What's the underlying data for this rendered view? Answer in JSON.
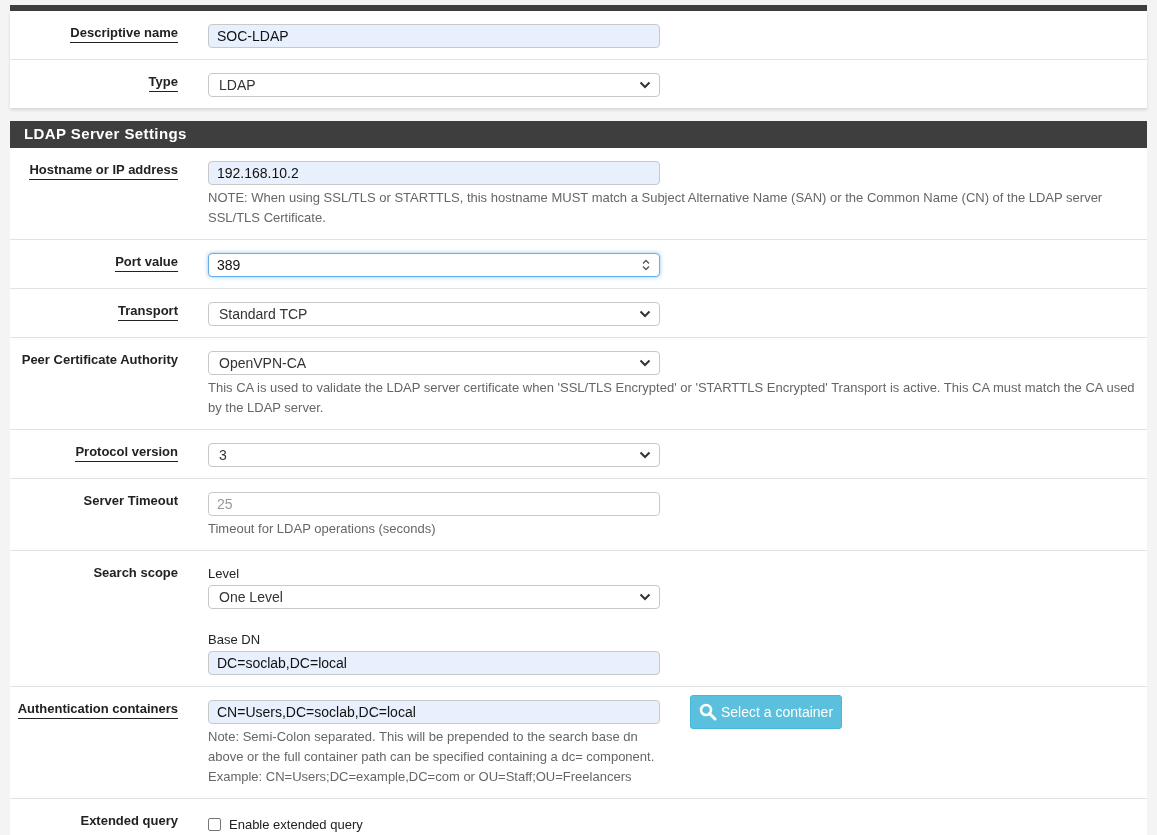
{
  "top_rows": [
    {
      "label": "Descriptive name",
      "help_link": true,
      "kind": "text",
      "value": "SOC-LDAP",
      "autofilled": true
    },
    {
      "label": "Type",
      "help_link": true,
      "kind": "select",
      "value": "LDAP"
    }
  ],
  "section": {
    "title": "LDAP Server Settings",
    "rows": [
      {
        "label": "Hostname or IP address",
        "help_link": true,
        "kind": "text",
        "value": "192.168.10.2",
        "autofilled": true,
        "help": "NOTE: When using SSL/TLS or STARTTLS, this hostname MUST match a Subject Alternative Name (SAN) or the Common Name (CN) of the LDAP server SSL/TLS Certificate."
      },
      {
        "label": "Port value",
        "help_link": true,
        "kind": "number",
        "value": "389",
        "focused": true
      },
      {
        "label": "Transport",
        "help_link": true,
        "kind": "select",
        "value": "Standard TCP"
      },
      {
        "label": "Peer Certificate Authority",
        "help_link": false,
        "kind": "select",
        "value": "OpenVPN-CA",
        "help": "This CA is used to validate the LDAP server certificate when 'SSL/TLS Encrypted' or 'STARTTLS Encrypted' Transport is active. This CA must match the CA used by the LDAP server."
      },
      {
        "label": "Protocol version",
        "help_link": true,
        "kind": "select",
        "value": "3"
      },
      {
        "label": "Server Timeout",
        "help_link": false,
        "kind": "text",
        "placeholder": "25",
        "help": "Timeout for LDAP operations (seconds)"
      },
      {
        "label": "Search scope",
        "help_link": false,
        "kind": "group",
        "fields": [
          {
            "caption": "Level",
            "kind": "select",
            "value": "One Level"
          },
          {
            "caption": "Base DN",
            "kind": "text",
            "value": "DC=soclab,DC=local",
            "autofilled": true
          }
        ]
      },
      {
        "label": "Authentication containers",
        "help_link": true,
        "kind": "text",
        "value": "CN=Users,DC=soclab,DC=local",
        "autofilled": true,
        "help": "Note: Semi-Colon separated. This will be prepended to the search base dn above or the full container path can be specified containing a dc= component.",
        "example": "Example: CN=Users;DC=example,DC=com or OU=Staff;OU=Freelancers",
        "button": "Select a container"
      },
      {
        "label": "Extended query",
        "help_link": false,
        "kind": "checkbox",
        "checked": false,
        "text": "Enable extended query"
      }
    ]
  }
}
